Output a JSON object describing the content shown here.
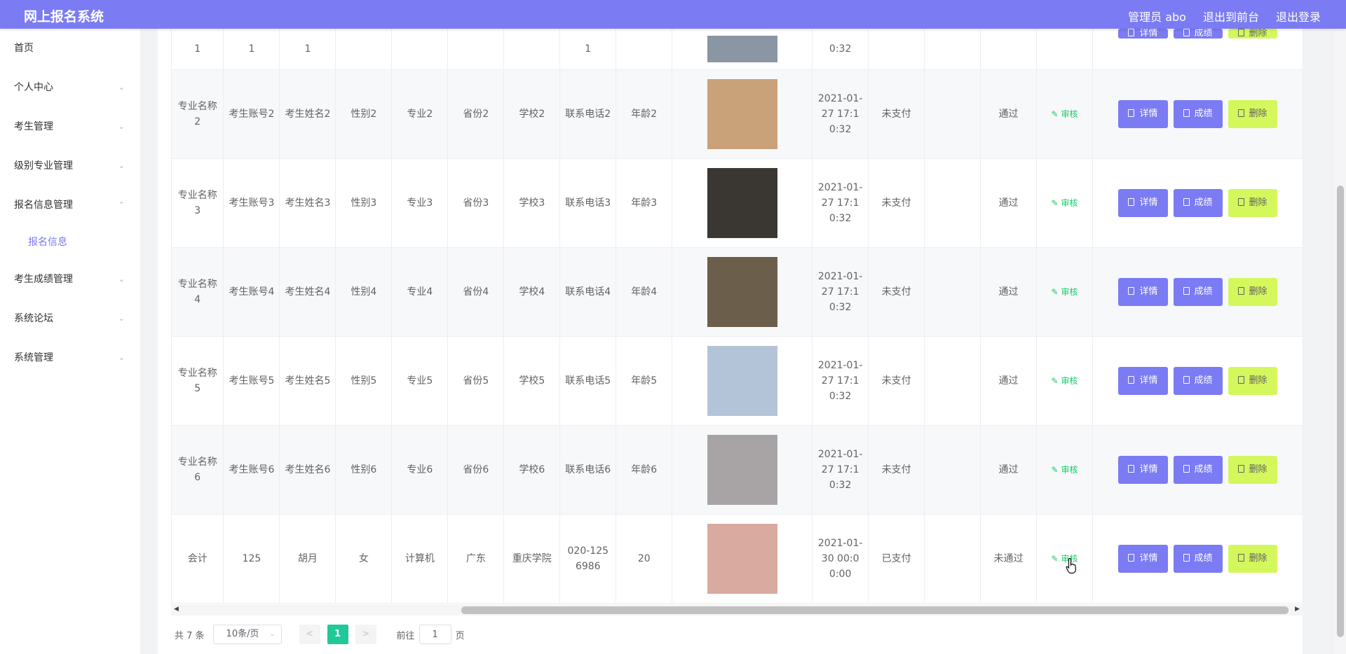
{
  "header": {
    "brand": "网上报名系统",
    "admin": "管理员 abo",
    "front": "退出到前台",
    "logout": "退出登录"
  },
  "sidebar": {
    "items": [
      {
        "label": "首页",
        "chevron": ""
      },
      {
        "label": "个人中心",
        "chevron": "⌄"
      },
      {
        "label": "考生管理",
        "chevron": "⌄"
      },
      {
        "label": "级别专业管理",
        "chevron": "⌄"
      },
      {
        "label": "报名信息管理",
        "chevron": "⌃"
      },
      {
        "label": "考生成绩管理",
        "chevron": "⌄"
      },
      {
        "label": "系统论坛",
        "chevron": "⌄"
      },
      {
        "label": "系统管理",
        "chevron": "⌄"
      }
    ],
    "subitem": "报名信息"
  },
  "table": {
    "rows": [
      {
        "major_name": "1",
        "account": "1",
        "name": "1",
        "gender": "",
        "major": "",
        "province": "",
        "school": "",
        "phone": "1",
        "age": "",
        "time": "0:32",
        "pay": "",
        "blank": "",
        "status": "",
        "photo_bg": "#8a96a4"
      },
      {
        "major_name": "专业名称2",
        "account": "考生账号2",
        "name": "考生姓名2",
        "gender": "性别2",
        "major": "专业2",
        "province": "省份2",
        "school": "学校2",
        "phone": "联系电话2",
        "age": "年龄2",
        "time": "2021-01-27 17:10:32",
        "pay": "未支付",
        "blank": "",
        "status": "通过",
        "photo_bg": "#c9a27a"
      },
      {
        "major_name": "专业名称3",
        "account": "考生账号3",
        "name": "考生姓名3",
        "gender": "性别3",
        "major": "专业3",
        "province": "省份3",
        "school": "学校3",
        "phone": "联系电话3",
        "age": "年龄3",
        "time": "2021-01-27 17:10:32",
        "pay": "未支付",
        "blank": "",
        "status": "通过",
        "photo_bg": "#3a3632"
      },
      {
        "major_name": "专业名称4",
        "account": "考生账号4",
        "name": "考生姓名4",
        "gender": "性别4",
        "major": "专业4",
        "province": "省份4",
        "school": "学校4",
        "phone": "联系电话4",
        "age": "年龄4",
        "time": "2021-01-27 17:10:32",
        "pay": "未支付",
        "blank": "",
        "status": "通过",
        "photo_bg": "#6b5e4a"
      },
      {
        "major_name": "专业名称5",
        "account": "考生账号5",
        "name": "考生姓名5",
        "gender": "性别5",
        "major": "专业5",
        "province": "省份5",
        "school": "学校5",
        "phone": "联系电话5",
        "age": "年龄5",
        "time": "2021-01-27 17:10:32",
        "pay": "未支付",
        "blank": "",
        "status": "通过",
        "photo_bg": "#b4c4d8"
      },
      {
        "major_name": "专业名称6",
        "account": "考生账号6",
        "name": "考生姓名6",
        "gender": "性别6",
        "major": "专业6",
        "province": "省份6",
        "school": "学校6",
        "phone": "联系电话6",
        "age": "年龄6",
        "time": "2021-01-27 17:10:32",
        "pay": "未支付",
        "blank": "",
        "status": "通过",
        "photo_bg": "#a8a4a6"
      },
      {
        "major_name": "会计",
        "account": "125",
        "name": "胡月",
        "gender": "女",
        "major": "计算机",
        "province": "广东",
        "school": "重庆学院",
        "phone": "020-1256986",
        "age": "20",
        "time": "2021-01-30 00:00:00",
        "pay": "已支付",
        "blank": "",
        "status": "未通过",
        "photo_bg": "#d8aaa0"
      }
    ],
    "audit_label": "审核",
    "btn_detail": "详情",
    "btn_score": "成绩",
    "btn_delete": "删除"
  },
  "pagination": {
    "total": "共 7 条",
    "size": "10条/页",
    "prev": "<",
    "page": "1",
    "next": ">",
    "goto_prefix": "前往",
    "goto_value": "1",
    "goto_suffix": "页"
  },
  "colors": {
    "accent": "#7b7bf4",
    "success": "#13ce66",
    "delete": "#d4f75c"
  }
}
